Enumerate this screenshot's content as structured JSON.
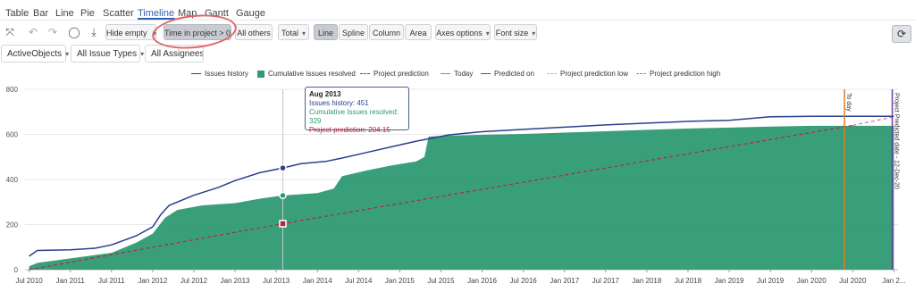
{
  "tabs": [
    "Table",
    "Bar",
    "Line",
    "Pie",
    "Scatter",
    "Timeline",
    "Map",
    "Gantt",
    "Gauge"
  ],
  "active_tab": "Timeline",
  "toolbar": {
    "hide_empty": "Hide empty",
    "time_in_project": "Time in project > 0",
    "all_others": "All others",
    "total": "Total",
    "line": "Line",
    "spline": "Spline",
    "column": "Column",
    "area": "Area",
    "axes_options": "Axes options",
    "font_size": "Font size"
  },
  "filters": {
    "dimension": "ActiveObjects",
    "issue_types": "All Issue Types",
    "assignees": "All Assignees"
  },
  "legend": [
    {
      "name": "Issues history",
      "color": "#2b3f8f"
    },
    {
      "name": "Cumulative Issues resolved",
      "color": "#2e9a74"
    },
    {
      "name": "Project prediction",
      "color": "#b5273d"
    },
    {
      "name": "Today",
      "color": "#e07b1f"
    },
    {
      "name": "Predicted on",
      "color": "#6b3fa0"
    },
    {
      "name": "Project prediction low",
      "color": "#bbbbbb"
    },
    {
      "name": "Project prediction high",
      "color": "#d36aa8"
    }
  ],
  "tooltip": {
    "title": "Aug 2013",
    "issues_history": "Issues history: 451",
    "cumulative": "Cumulative Issues resolved: 329",
    "prediction": "Project prediction: 204.15"
  },
  "chart_data": {
    "type": "area",
    "x_ticks": [
      "Jul 2010",
      "Jan 2011",
      "Jul 2011",
      "Jan 2012",
      "Jul 2012",
      "Jan 2013",
      "Jul 2013",
      "Jan 2014",
      "Jul 2014",
      "Jan 2015",
      "Jul 2015",
      "Jan 2016",
      "Jul 2016",
      "Jan 2017",
      "Jul 2017",
      "Jan 2018",
      "Jul 2018",
      "Jan 2019",
      "Jul 2019",
      "Jan 2020",
      "Jul 2020",
      "Jan 2..."
    ],
    "y_ticks": [
      "0",
      "200",
      "400",
      "600",
      "800"
    ],
    "ylim": [
      0,
      800
    ],
    "xlim": [
      2010.45,
      2021.05
    ],
    "series": [
      {
        "name": "Issues history",
        "points": [
          [
            2010.5,
            60
          ],
          [
            2010.6,
            85
          ],
          [
            2011.0,
            88
          ],
          [
            2011.3,
            95
          ],
          [
            2011.5,
            110
          ],
          [
            2011.8,
            150
          ],
          [
            2012.0,
            190
          ],
          [
            2012.1,
            245
          ],
          [
            2012.2,
            285
          ],
          [
            2012.5,
            330
          ],
          [
            2012.8,
            365
          ],
          [
            2013.0,
            395
          ],
          [
            2013.3,
            430
          ],
          [
            2013.58,
            451
          ],
          [
            2013.8,
            470
          ],
          [
            2014.1,
            480
          ],
          [
            2014.3,
            495
          ],
          [
            2014.6,
            520
          ],
          [
            2014.9,
            545
          ],
          [
            2015.2,
            570
          ],
          [
            2015.6,
            598
          ],
          [
            2016.0,
            612
          ],
          [
            2016.5,
            622
          ],
          [
            2017.0,
            632
          ],
          [
            2017.5,
            642
          ],
          [
            2018.0,
            650
          ],
          [
            2018.5,
            658
          ],
          [
            2019.0,
            662
          ],
          [
            2019.5,
            678
          ],
          [
            2020.0,
            680
          ],
          [
            2020.5,
            680
          ],
          [
            2021.0,
            680
          ]
        ]
      },
      {
        "name": "Cumulative Issues resolved",
        "points": [
          [
            2010.5,
            15
          ],
          [
            2010.6,
            30
          ],
          [
            2011.0,
            50
          ],
          [
            2011.3,
            65
          ],
          [
            2011.5,
            75
          ],
          [
            2011.8,
            120
          ],
          [
            2012.0,
            160
          ],
          [
            2012.15,
            230
          ],
          [
            2012.3,
            265
          ],
          [
            2012.6,
            285
          ],
          [
            2013.0,
            295
          ],
          [
            2013.3,
            315
          ],
          [
            2013.58,
            329
          ],
          [
            2014.0,
            340
          ],
          [
            2014.2,
            360
          ],
          [
            2014.3,
            415
          ],
          [
            2014.6,
            440
          ],
          [
            2014.9,
            462
          ],
          [
            2015.2,
            480
          ],
          [
            2015.3,
            500
          ],
          [
            2015.35,
            590
          ],
          [
            2015.6,
            595
          ],
          [
            2016.0,
            598
          ],
          [
            2016.5,
            602
          ],
          [
            2017.0,
            608
          ],
          [
            2017.5,
            614
          ],
          [
            2018.0,
            620
          ],
          [
            2018.5,
            626
          ],
          [
            2019.0,
            630
          ],
          [
            2019.5,
            635
          ],
          [
            2020.0,
            638
          ],
          [
            2020.5,
            638
          ],
          [
            2021.0,
            638
          ]
        ]
      },
      {
        "name": "Project prediction",
        "points": [
          [
            2010.5,
            0
          ],
          [
            2013.58,
            204.15
          ],
          [
            2020.5,
            640
          ]
        ]
      },
      {
        "name": "Project prediction high",
        "points": [
          [
            2020.5,
            640
          ],
          [
            2021.0,
            678
          ]
        ]
      }
    ],
    "today_x": 2020.4,
    "predicted_on_x": 2020.98,
    "vertical_labels": [
      "To day",
      "Project Predicted date - 12-Dec-20"
    ]
  }
}
